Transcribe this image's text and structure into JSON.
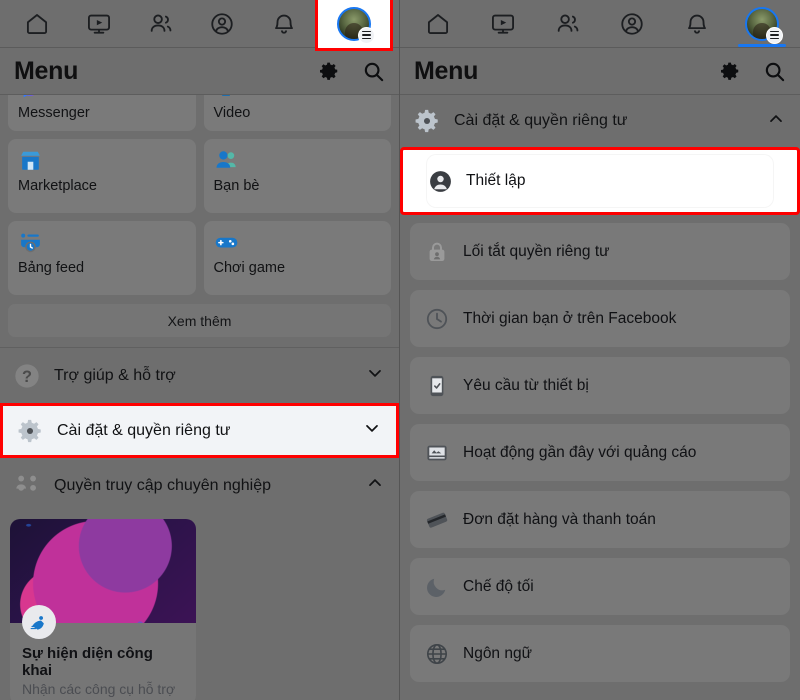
{
  "topbar": {
    "tabs": [
      {
        "name": "home",
        "icon": "home-icon"
      },
      {
        "name": "video",
        "icon": "video-icon"
      },
      {
        "name": "groups",
        "icon": "groups-icon"
      },
      {
        "name": "profile",
        "icon": "profile-circle-icon"
      },
      {
        "name": "notifications",
        "icon": "bell-icon"
      },
      {
        "name": "menu",
        "icon": "avatar-menu-icon"
      }
    ]
  },
  "header": {
    "title": "Menu",
    "gear_icon": "gear-icon",
    "search_icon": "search-icon"
  },
  "left": {
    "grid": [
      {
        "label": "Messenger",
        "icon": "messenger-icon"
      },
      {
        "label": "Video",
        "icon": "video-play-icon"
      },
      {
        "label": "Marketplace",
        "icon": "storefront-icon"
      },
      {
        "label": "Bạn bè",
        "icon": "friends-icon"
      },
      {
        "label": "Bảng feed",
        "icon": "feeds-icon"
      },
      {
        "label": "Chơi game",
        "icon": "gamepad-icon"
      }
    ],
    "see_more": "Xem thêm",
    "rows": [
      {
        "label": "Trợ giúp & hỗ trợ",
        "icon": "question-circle-icon",
        "chevron": "down",
        "highlighted": false
      },
      {
        "label": "Cài đặt & quyền riêng tư",
        "icon": "settings-gear-icon",
        "chevron": "down",
        "highlighted": true
      },
      {
        "label": "Quyền truy cập chuyên nghiệp",
        "icon": "professional-access-icon",
        "chevron": "up",
        "highlighted": false
      }
    ],
    "promo": {
      "title": "Sự hiện diện công khai",
      "subtitle": "Nhận các công cụ hỗ trợ",
      "badge_icon": "rocket-person-icon"
    }
  },
  "right": {
    "section": {
      "label": "Cài đặt & quyền riêng tư",
      "icon": "settings-gear-icon",
      "chevron": "up"
    },
    "items": [
      {
        "label": "Thiết lập",
        "icon": "account-circle-icon",
        "highlighted": true
      },
      {
        "label": "Lối tắt quyền riêng tư",
        "icon": "privacy-lock-icon",
        "highlighted": false
      },
      {
        "label": "Thời gian bạn ở trên Facebook",
        "icon": "clock-icon",
        "highlighted": false
      },
      {
        "label": "Yêu cầu từ thiết bị",
        "icon": "device-request-icon",
        "highlighted": false
      },
      {
        "label": "Hoạt động gần đây với quảng cáo",
        "icon": "ad-activity-icon",
        "highlighted": false
      },
      {
        "label": "Đơn đặt hàng và thanh toán",
        "icon": "payment-card-icon",
        "highlighted": false
      },
      {
        "label": "Chế độ tối",
        "icon": "moon-icon",
        "highlighted": false
      },
      {
        "label": "Ngôn ngữ",
        "icon": "globe-icon",
        "highlighted": false
      }
    ]
  },
  "colors": {
    "highlight_red": "#ff0000",
    "facebook_blue": "#1877f2",
    "overlay_gray": "#6e6e6e"
  }
}
